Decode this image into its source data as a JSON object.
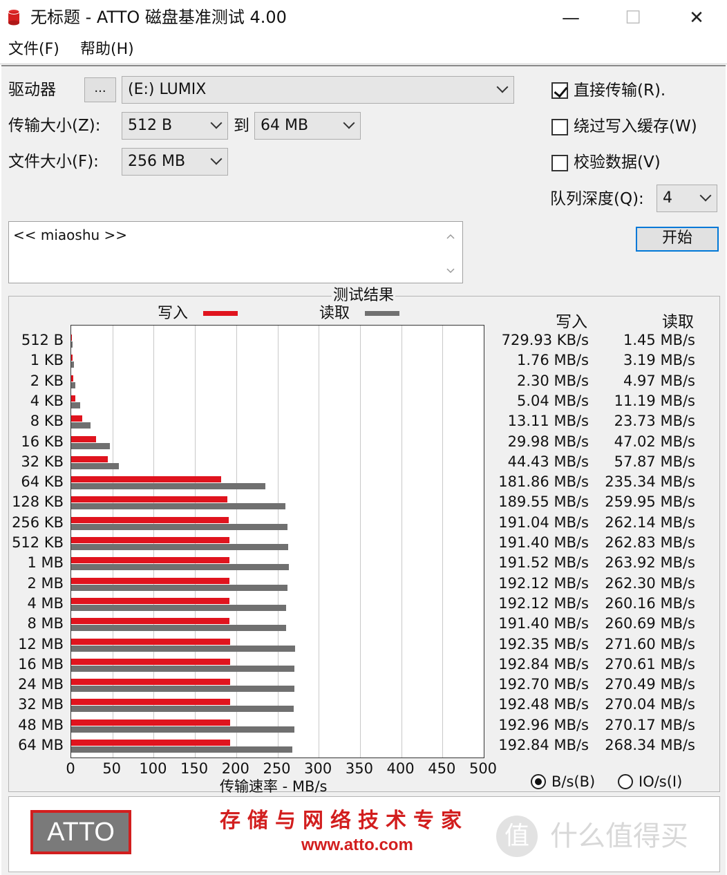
{
  "window": {
    "title": "无标题 - ATTO 磁盘基准测试 4.00",
    "minimize_glyph": "—",
    "maximize_glyph": "☐",
    "close_glyph": "✕"
  },
  "menu": [
    "文件(F)",
    "帮助(H)"
  ],
  "settings": {
    "drive_label": "驱动器",
    "browse_label": "...",
    "drive_value": "(E:) LUMIX",
    "transfer_label": "传输大小(Z):",
    "transfer_from": "512 B",
    "to_label": "到",
    "transfer_to": "64 MB",
    "filesize_label": "文件大小(F):",
    "filesize_value": "256 MB",
    "direct_io_label": "直接传输(R).",
    "direct_io_checked": true,
    "bypass_cache_label": "绕过写入缓存(W)",
    "bypass_cache_checked": false,
    "verify_label": "校验数据(V)",
    "verify_checked": false,
    "queue_label": "队列深度(Q):",
    "queue_value": "4",
    "start_label": "开始"
  },
  "description": "<< miaoshu >>",
  "results": {
    "title": "测试结果",
    "legend_write": "写入",
    "legend_read": "读取",
    "col_write": "写入",
    "col_read": "读取",
    "xlabel": "传输速率 - MB/s",
    "radio_bytes": "B/s(B)",
    "radio_io": "IO/s(I)",
    "radio_bytes_selected": true
  },
  "colors": {
    "write": "#e0141e",
    "read": "#707070",
    "accent": "#0078d7",
    "brand_red": "#d21e1e"
  },
  "chart_data": {
    "type": "bar",
    "orientation": "horizontal",
    "categories": [
      "512 B",
      "1 KB",
      "2 KB",
      "4 KB",
      "8 KB",
      "16 KB",
      "32 KB",
      "64 KB",
      "128 KB",
      "256 KB",
      "512 KB",
      "1 MB",
      "2 MB",
      "4 MB",
      "8 MB",
      "12 MB",
      "16 MB",
      "24 MB",
      "32 MB",
      "48 MB",
      "64 MB"
    ],
    "series": [
      {
        "name": "写入",
        "values": [
          0.71,
          1.76,
          2.3,
          5.04,
          13.11,
          29.98,
          44.43,
          181.86,
          189.55,
          191.04,
          191.4,
          191.52,
          192.12,
          192.12,
          191.4,
          192.35,
          192.84,
          192.7,
          192.48,
          192.96,
          192.84
        ]
      },
      {
        "name": "读取",
        "values": [
          1.45,
          3.19,
          4.97,
          11.19,
          23.73,
          47.02,
          57.87,
          235.34,
          259.95,
          262.14,
          262.83,
          263.92,
          262.3,
          260.16,
          260.69,
          271.6,
          270.61,
          270.49,
          270.04,
          270.17,
          268.34
        ]
      }
    ],
    "write_labels": [
      "729.93 KB/s",
      "1.76 MB/s",
      "2.30 MB/s",
      "5.04 MB/s",
      "13.11 MB/s",
      "29.98 MB/s",
      "44.43 MB/s",
      "181.86 MB/s",
      "189.55 MB/s",
      "191.04 MB/s",
      "191.40 MB/s",
      "191.52 MB/s",
      "192.12 MB/s",
      "192.12 MB/s",
      "191.40 MB/s",
      "192.35 MB/s",
      "192.84 MB/s",
      "192.70 MB/s",
      "192.48 MB/s",
      "192.96 MB/s",
      "192.84 MB/s"
    ],
    "read_labels": [
      "1.45 MB/s",
      "3.19 MB/s",
      "4.97 MB/s",
      "11.19 MB/s",
      "23.73 MB/s",
      "47.02 MB/s",
      "57.87 MB/s",
      "235.34 MB/s",
      "259.95 MB/s",
      "262.14 MB/s",
      "262.83 MB/s",
      "263.92 MB/s",
      "262.30 MB/s",
      "260.16 MB/s",
      "260.69 MB/s",
      "271.60 MB/s",
      "270.61 MB/s",
      "270.49 MB/s",
      "270.04 MB/s",
      "270.17 MB/s",
      "268.34 MB/s"
    ],
    "xticks": [
      "0",
      "50",
      "100",
      "150",
      "200",
      "250",
      "300",
      "350",
      "400",
      "450",
      "500"
    ],
    "xlim": [
      0,
      500
    ],
    "xlabel": "传输速率 - MB/s",
    "grid": true
  },
  "banner": {
    "logo": "ATTO",
    "slogan": "存储与网络技术专家",
    "url": "www.atto.com"
  },
  "watermark": {
    "circle_char": "值",
    "text": "什么值得买"
  }
}
